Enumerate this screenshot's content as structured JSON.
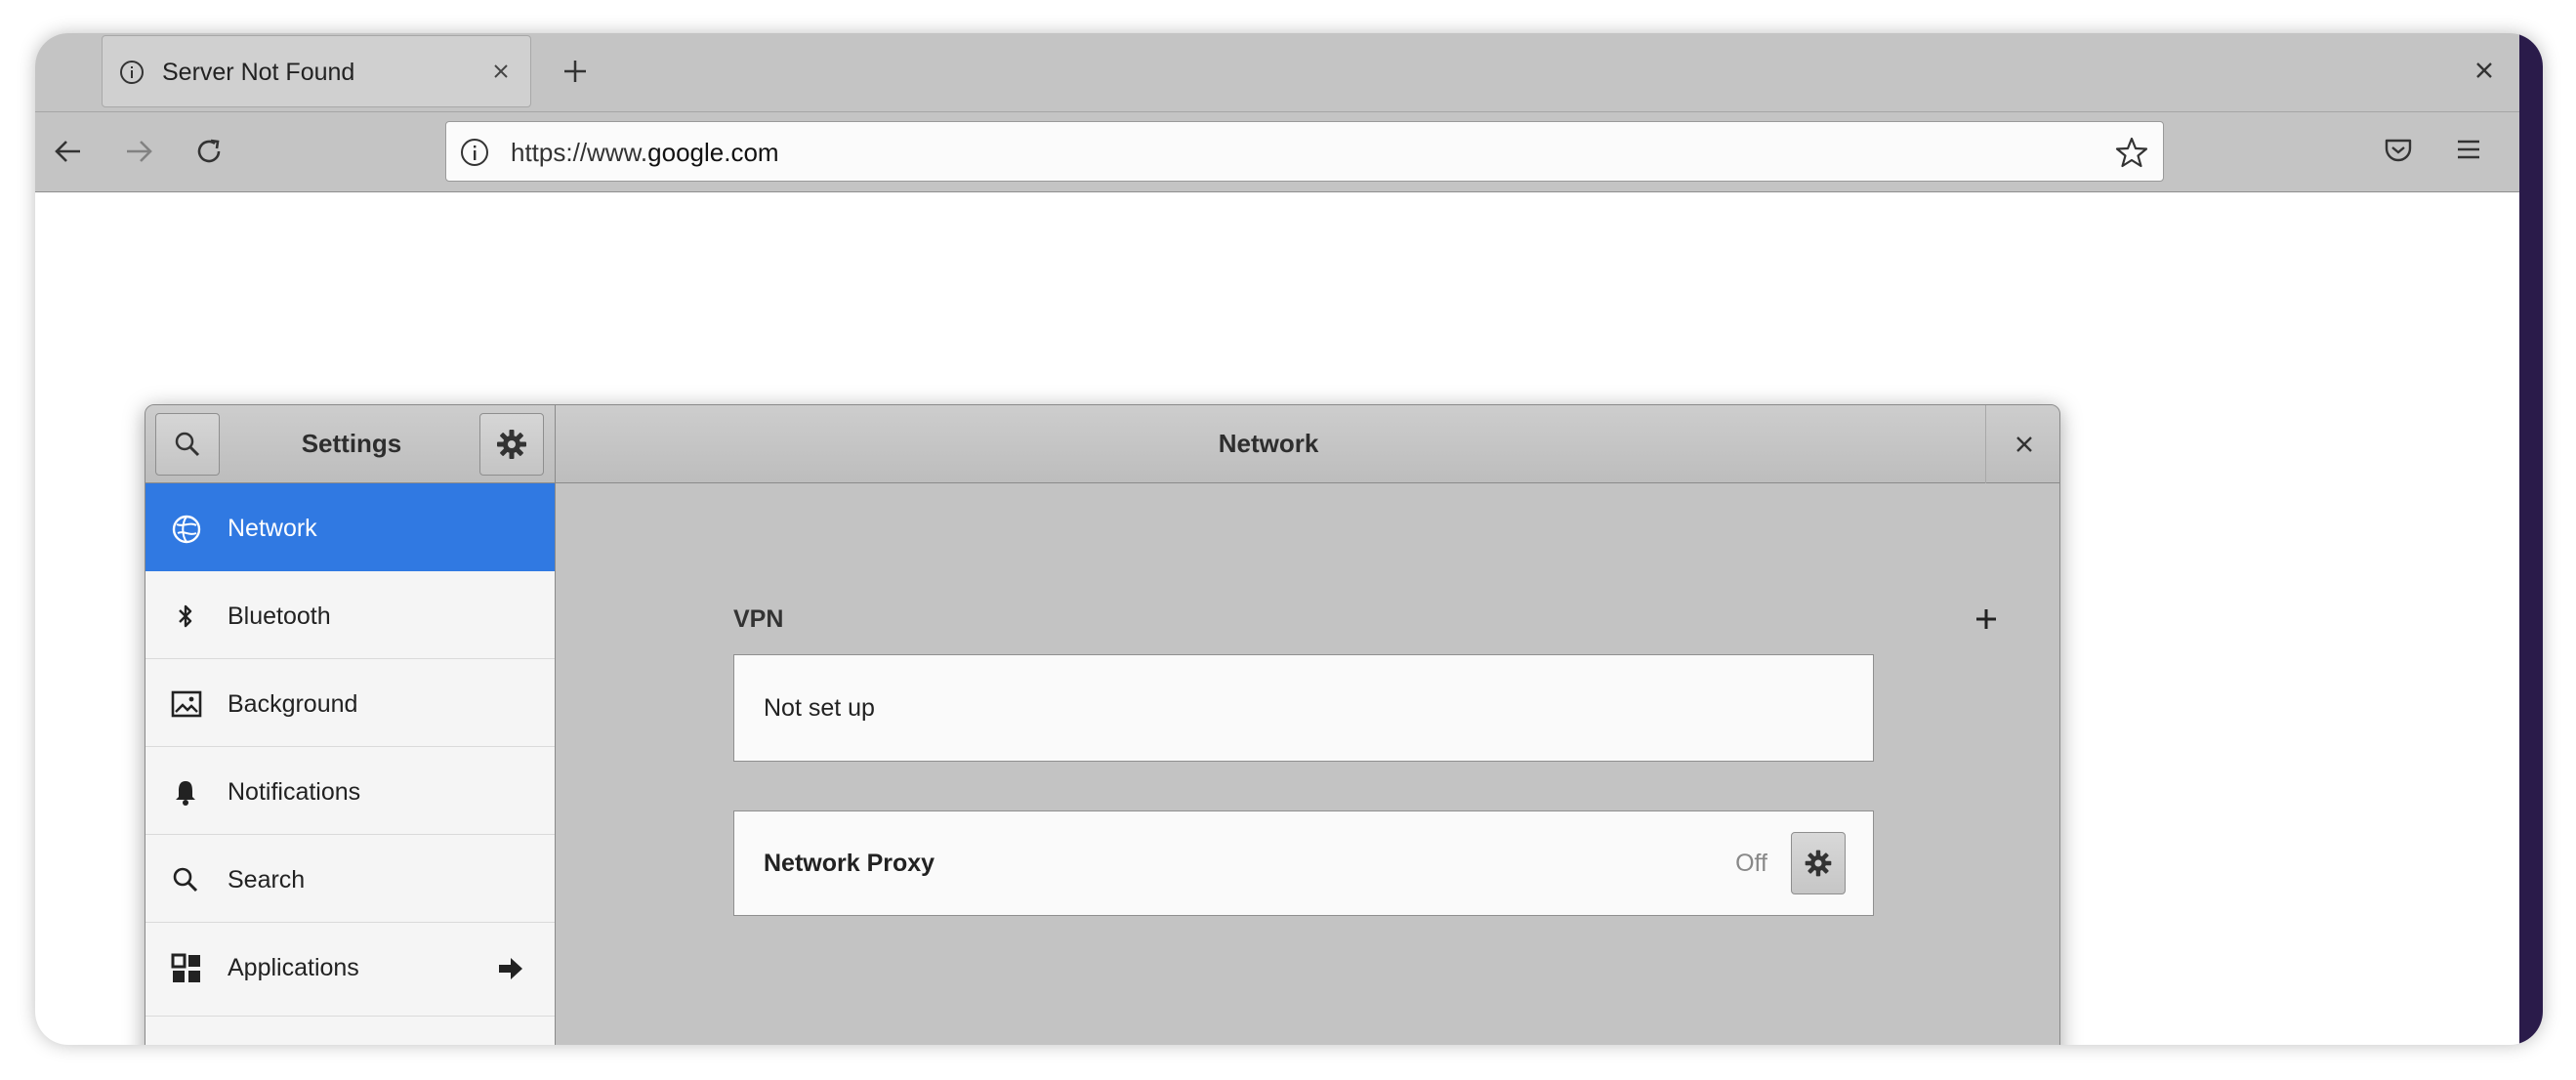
{
  "browser": {
    "tab": {
      "title": "Server Not Found",
      "icon": "info-icon",
      "close_icon": "close-icon"
    },
    "new_tab_icon": "plus-icon",
    "window_close_icon": "close-icon",
    "nav": {
      "back_icon": "arrow-left-icon",
      "forward_icon": "arrow-right-icon",
      "reload_icon": "reload-icon",
      "url_prefix": "https://www.",
      "url_domain": "google.com",
      "bookmark_icon": "star-icon",
      "pocket_icon": "pocket-icon",
      "menu_icon": "hamburger-menu-icon"
    }
  },
  "settings": {
    "title": "Settings",
    "search_icon": "search-icon",
    "gear_icon": "gear-icon",
    "panel_title": "Network",
    "close_icon": "close-icon",
    "sidebar": {
      "items": [
        {
          "label": "Network",
          "icon": "network-icon",
          "active": true
        },
        {
          "label": "Bluetooth",
          "icon": "bluetooth-icon"
        },
        {
          "label": "Background",
          "icon": "background-image-icon"
        },
        {
          "label": "Notifications",
          "icon": "bell-icon"
        },
        {
          "label": "Search",
          "icon": "search-icon"
        },
        {
          "label": "Applications",
          "icon": "applications-grid-icon",
          "trailing_icon": "arrow-right-icon"
        }
      ]
    },
    "vpn": {
      "heading": "VPN",
      "add_icon": "plus-icon",
      "empty_text": "Not set up"
    },
    "proxy": {
      "label": "Network Proxy",
      "status": "Off",
      "settings_icon": "gear-icon"
    }
  },
  "colors": {
    "accent": "#3079e2",
    "chrome_bg": "#c4c4c4",
    "window_bg": "#c3c3c3",
    "desktop_edge": "#2a1b4a"
  }
}
